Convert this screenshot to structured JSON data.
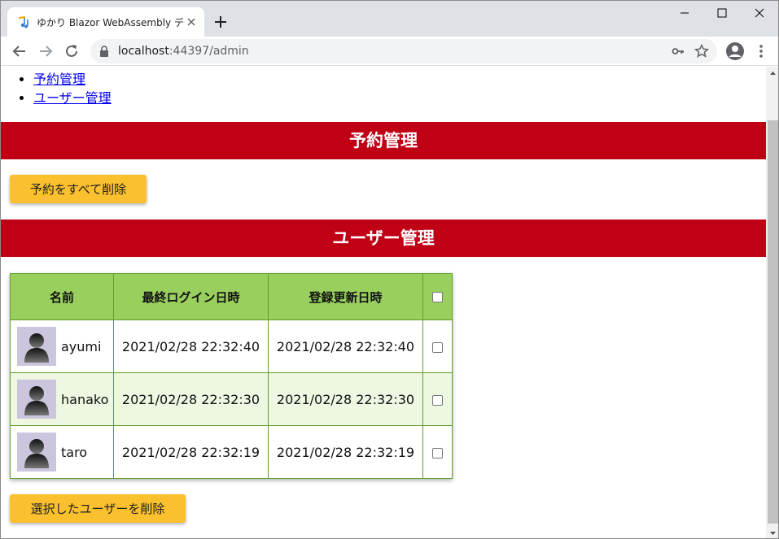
{
  "browser": {
    "tab_title": "ゆかり Blazor WebAssembly デモ",
    "url_host": "localhost",
    "url_rest": ":44397/admin"
  },
  "nav": {
    "items": [
      {
        "label": "予約管理"
      },
      {
        "label": "ユーザー管理"
      }
    ]
  },
  "reservations": {
    "header": "予約管理",
    "delete_all_label": "予約をすべて削除"
  },
  "users": {
    "header": "ユーザー管理",
    "columns": {
      "name": "名前",
      "last_login": "最終ログイン日時",
      "updated": "登録更新日時"
    },
    "rows": [
      {
        "name": "ayumi",
        "last_login": "2021/02/28 22:32:40",
        "updated": "2021/02/28 22:32:40"
      },
      {
        "name": "hanako",
        "last_login": "2021/02/28 22:32:30",
        "updated": "2021/02/28 22:32:30"
      },
      {
        "name": "taro",
        "last_login": "2021/02/28 22:32:19",
        "updated": "2021/02/28 22:32:19"
      }
    ],
    "delete_selected_label": "選択したユーザーを削除"
  },
  "colors": {
    "header_red": "#c00015",
    "button_yellow": "#fbc02d",
    "table_header_green": "#99cf5d",
    "link_blue": "#0000ee"
  },
  "icons": [
    "music-note-icon",
    "close-icon",
    "plus-icon",
    "minimize-icon",
    "maximize-icon",
    "back-arrow-icon",
    "forward-arrow-icon",
    "reload-icon",
    "lock-icon",
    "key-icon",
    "star-icon",
    "profile-icon",
    "menu-dots-icon",
    "avatar-silhouette-icon"
  ]
}
